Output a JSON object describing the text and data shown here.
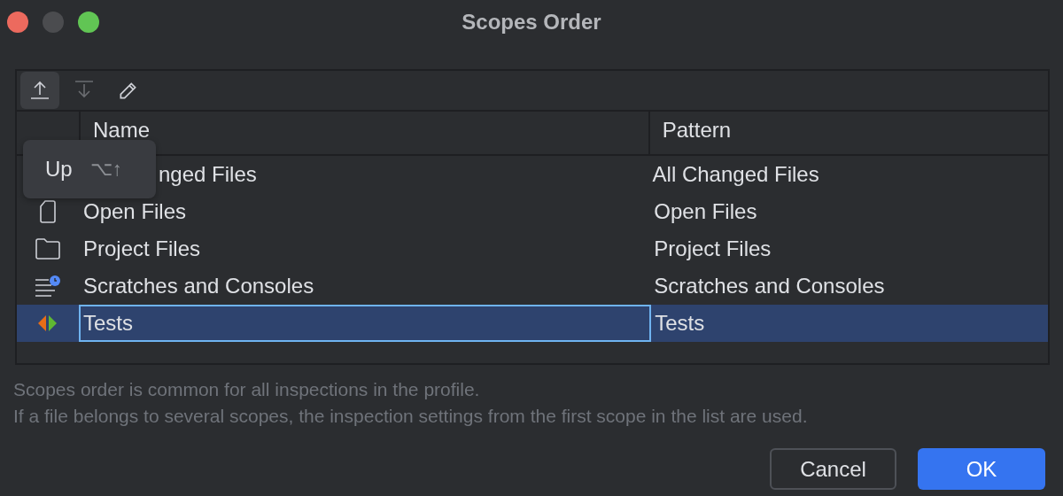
{
  "window": {
    "title": "Scopes Order"
  },
  "toolbar": [
    {
      "kind": "up",
      "selected": true,
      "disabled": false
    },
    {
      "kind": "down",
      "selected": false,
      "disabled": true
    },
    {
      "kind": "edit",
      "selected": false,
      "disabled": false
    }
  ],
  "table": {
    "columns": [
      "Name",
      "Pattern"
    ],
    "rows": [
      {
        "kind": "none",
        "name": "nged Files",
        "pattern": "All Changed Files",
        "covered": true,
        "selected": false
      },
      {
        "kind": "file",
        "name": "Open Files",
        "pattern": "Open Files",
        "covered": false,
        "selected": false
      },
      {
        "kind": "folder",
        "name": "Project Files",
        "pattern": "Project Files",
        "covered": false,
        "selected": false
      },
      {
        "kind": "scratch",
        "name": "Scratches and Consoles",
        "pattern": "Scratches and Consoles",
        "covered": false,
        "selected": false
      },
      {
        "kind": "tests",
        "name": "Tests",
        "pattern": "Tests",
        "covered": false,
        "selected": true
      }
    ]
  },
  "tooltip": {
    "label": "Up",
    "shortcut": "⌥↑"
  },
  "notes": [
    "Scopes order is common for all inspections in the profile.",
    "If a file belongs to several scopes, the inspection settings from the first scope in the list are used."
  ],
  "buttons": [
    {
      "label": "Cancel",
      "kind": "secondary"
    },
    {
      "label": "OK",
      "kind": "primary"
    }
  ]
}
